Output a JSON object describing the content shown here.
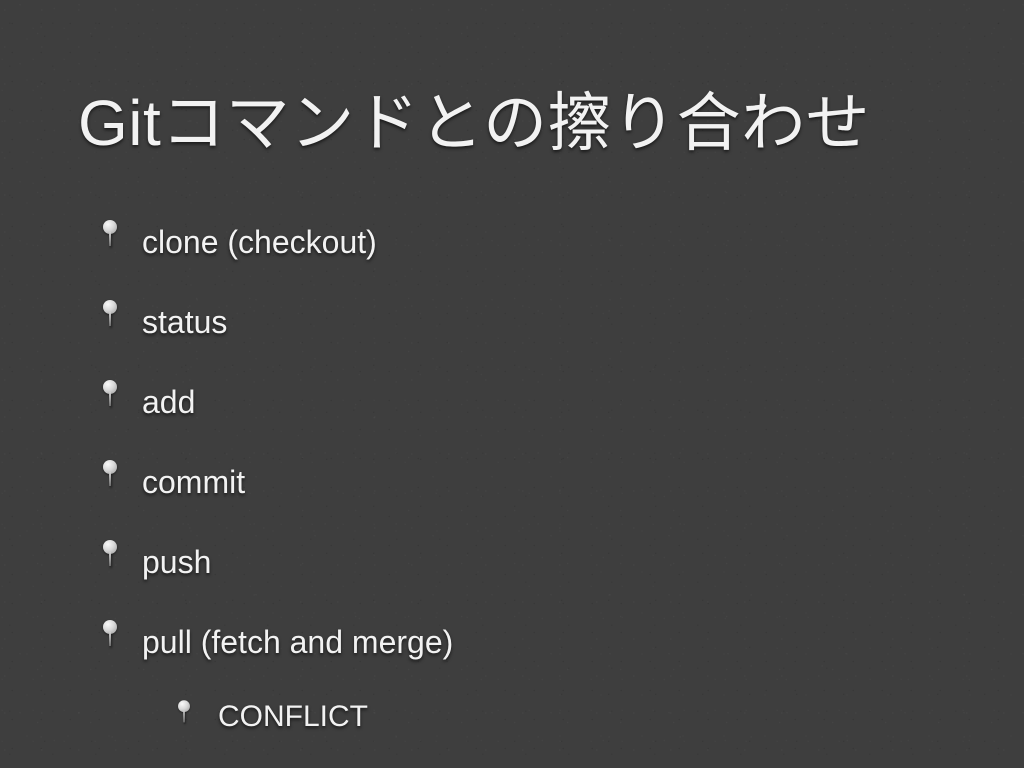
{
  "slide": {
    "title": "Gitコマンドとの擦り合わせ",
    "bullets": [
      {
        "text": "clone (checkout)"
      },
      {
        "text": "status"
      },
      {
        "text": "add"
      },
      {
        "text": "commit"
      },
      {
        "text": "push"
      },
      {
        "text": "pull (fetch and merge)",
        "children": [
          {
            "text": "CONFLICT"
          }
        ]
      }
    ]
  }
}
